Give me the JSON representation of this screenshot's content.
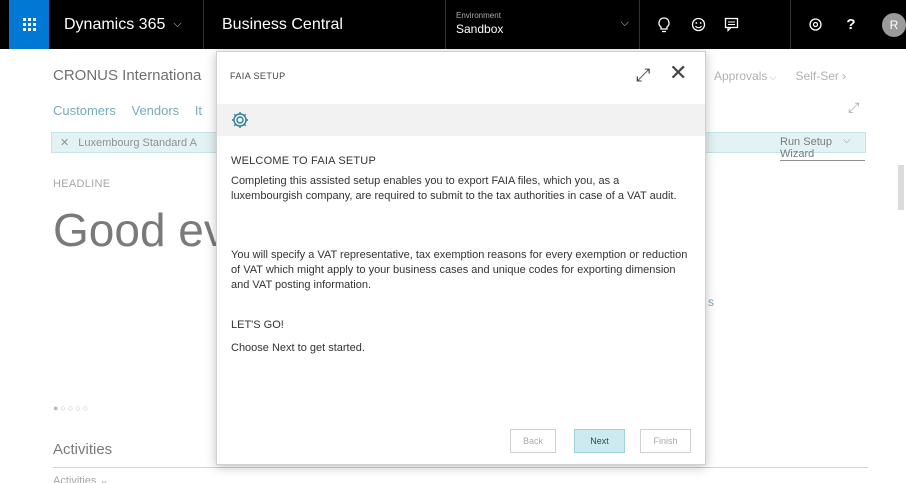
{
  "topbar": {
    "app_name": "Dynamics 365",
    "product": "Business Central",
    "environment_label": "Environment",
    "environment_value": "Sandbox",
    "avatar_initial": "R"
  },
  "background": {
    "company": "CRONUS Internationa",
    "nav_links": [
      "Customers",
      "Vendors",
      "It"
    ],
    "notice_text": "Luxembourg Standard A",
    "setup_link": "Run Setup Wizard",
    "right_menu": [
      "Approvals",
      "Self-Ser"
    ],
    "headline_label": "HEADLINE",
    "headline": "Good eve",
    "fragment": "s",
    "carousel_dots": "●○○○○",
    "activities_title": "Activities",
    "activities_sub": "Activities ⌄"
  },
  "dialog": {
    "title": "FAIA SETUP",
    "heading": "WELCOME TO FAIA SETUP",
    "paragraph1": "Completing this assisted setup enables you to export FAIA files, which you, as a luxembourgish company, are required to submit to the tax authorities in case of a VAT audit.",
    "paragraph2": "You will specify a VAT representative, tax exemption reasons for every exemption or reduction of VAT which might apply to your business cases and unique codes for exporting dimension and VAT posting information.",
    "heading2": "LET'S GO!",
    "paragraph3": "Choose Next to get started.",
    "buttons": {
      "back": "Back",
      "next": "Next",
      "finish": "Finish"
    }
  },
  "icons": [
    "waffle-icon",
    "chevron-down-icon",
    "lightbulb-icon",
    "smiley-icon",
    "chat-icon",
    "settings-icon",
    "help-icon",
    "expand-icon",
    "close-icon",
    "gear-icon"
  ]
}
